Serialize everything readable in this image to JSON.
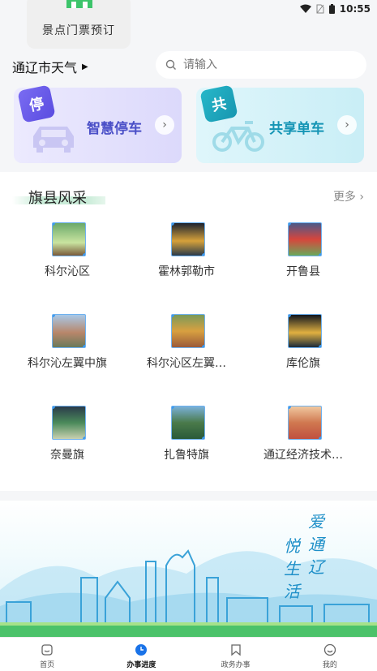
{
  "status_bar": {
    "time": "10:55"
  },
  "top": {
    "scenic_label": "景点门票预订",
    "weather_label": "通辽市天气",
    "search_placeholder": "请输入"
  },
  "services": [
    {
      "badge": "停",
      "title": "智慧停车",
      "icon": "car-icon"
    },
    {
      "badge": "共",
      "title": "共享单车",
      "icon": "bicycle-icon"
    }
  ],
  "counties": {
    "title": "旗县风采",
    "more": "更多",
    "items": [
      {
        "label": "科尔沁区"
      },
      {
        "label": "霍林郭勒市"
      },
      {
        "label": "开鲁县"
      },
      {
        "label": "科尔沁左翼中旗"
      },
      {
        "label": "科尔沁区左翼…"
      },
      {
        "label": "库伦旗"
      },
      {
        "label": "奈曼旗"
      },
      {
        "label": "扎鲁特旗"
      },
      {
        "label": "通辽经济技术…"
      }
    ]
  },
  "banner": {
    "slogan": [
      "爱",
      "通",
      "辽",
      "悦",
      "生",
      "活"
    ]
  },
  "tabs": [
    {
      "label": "首页",
      "icon": "home-icon"
    },
    {
      "label": "办事进度",
      "icon": "clock-icon",
      "active": true
    },
    {
      "label": "政务办事",
      "icon": "bookmark-icon"
    },
    {
      "label": "我的",
      "icon": "smile-icon"
    }
  ],
  "colors": {
    "accent": "#1a73e8",
    "park": "#4a4fc7",
    "bike": "#1595b5",
    "green": "#3cc46a"
  }
}
